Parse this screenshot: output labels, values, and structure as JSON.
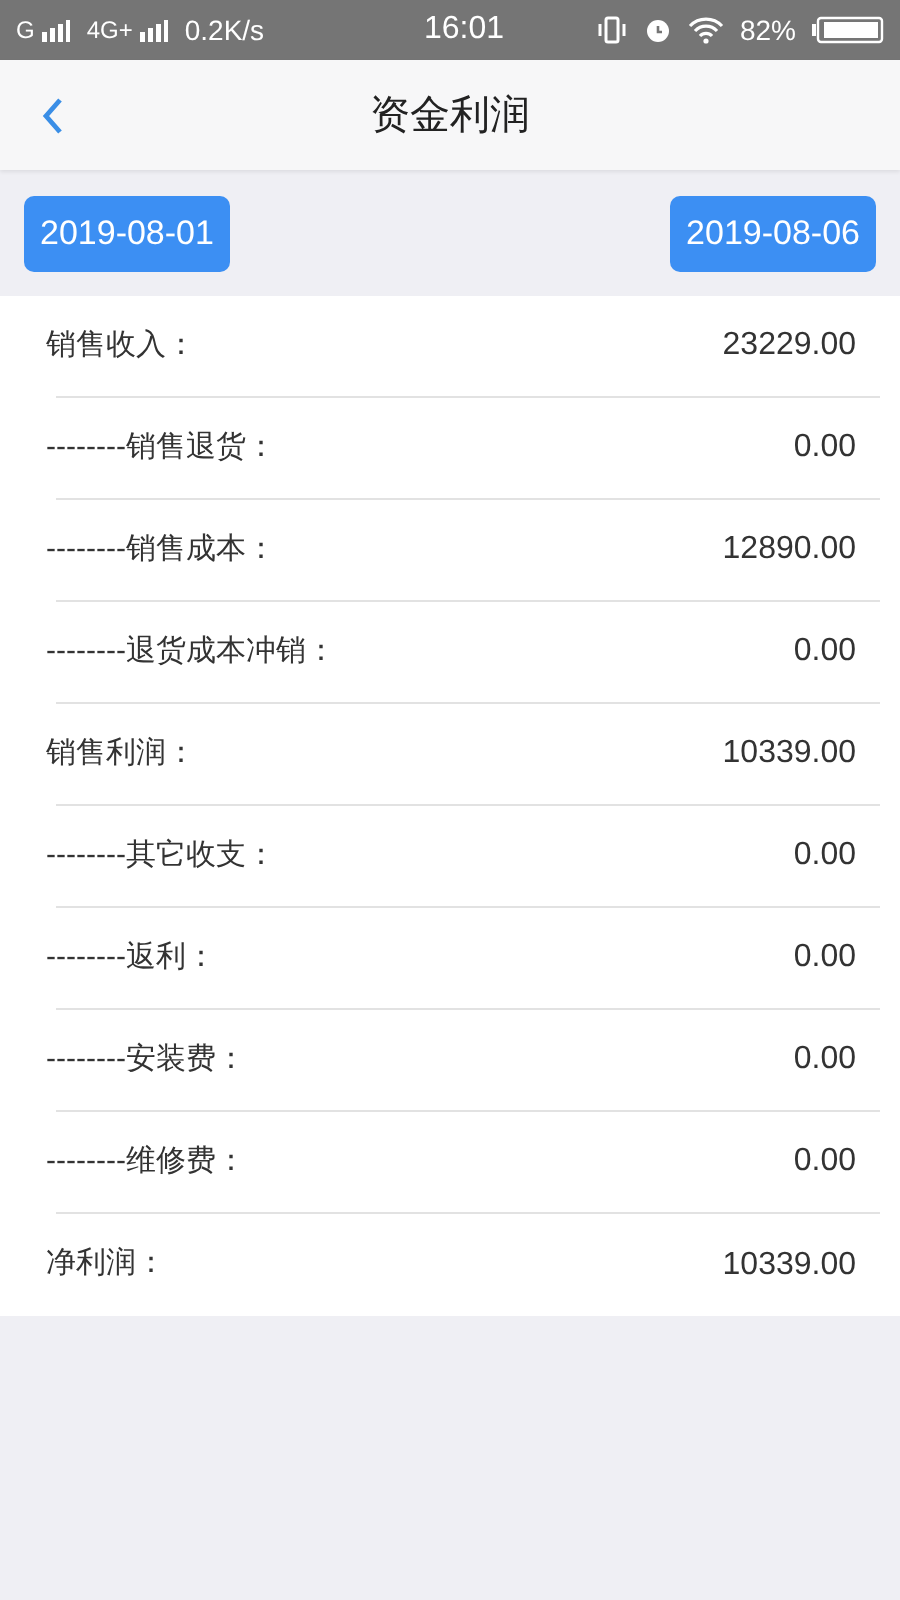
{
  "status_bar": {
    "carrier_1": "G",
    "carrier_2": "4G+",
    "speed": "0.2K/s",
    "time": "16:01",
    "battery": "82%"
  },
  "header": {
    "title": "资金利润"
  },
  "dates": {
    "start": "2019-08-01",
    "end": "2019-08-06"
  },
  "rows": [
    {
      "label": "销售收入：",
      "value": "23229.00"
    },
    {
      "label": "--------销售退货：",
      "value": "0.00"
    },
    {
      "label": "--------销售成本：",
      "value": "12890.00"
    },
    {
      "label": "--------退货成本冲销：",
      "value": "0.00"
    },
    {
      "label": "销售利润：",
      "value": "10339.00"
    },
    {
      "label": "--------其它收支：",
      "value": "0.00"
    },
    {
      "label": "--------返利：",
      "value": "0.00"
    },
    {
      "label": "--------安装费：",
      "value": "0.00"
    },
    {
      "label": "--------维修费：",
      "value": "0.00"
    },
    {
      "label": "净利润：",
      "value": "10339.00"
    }
  ]
}
